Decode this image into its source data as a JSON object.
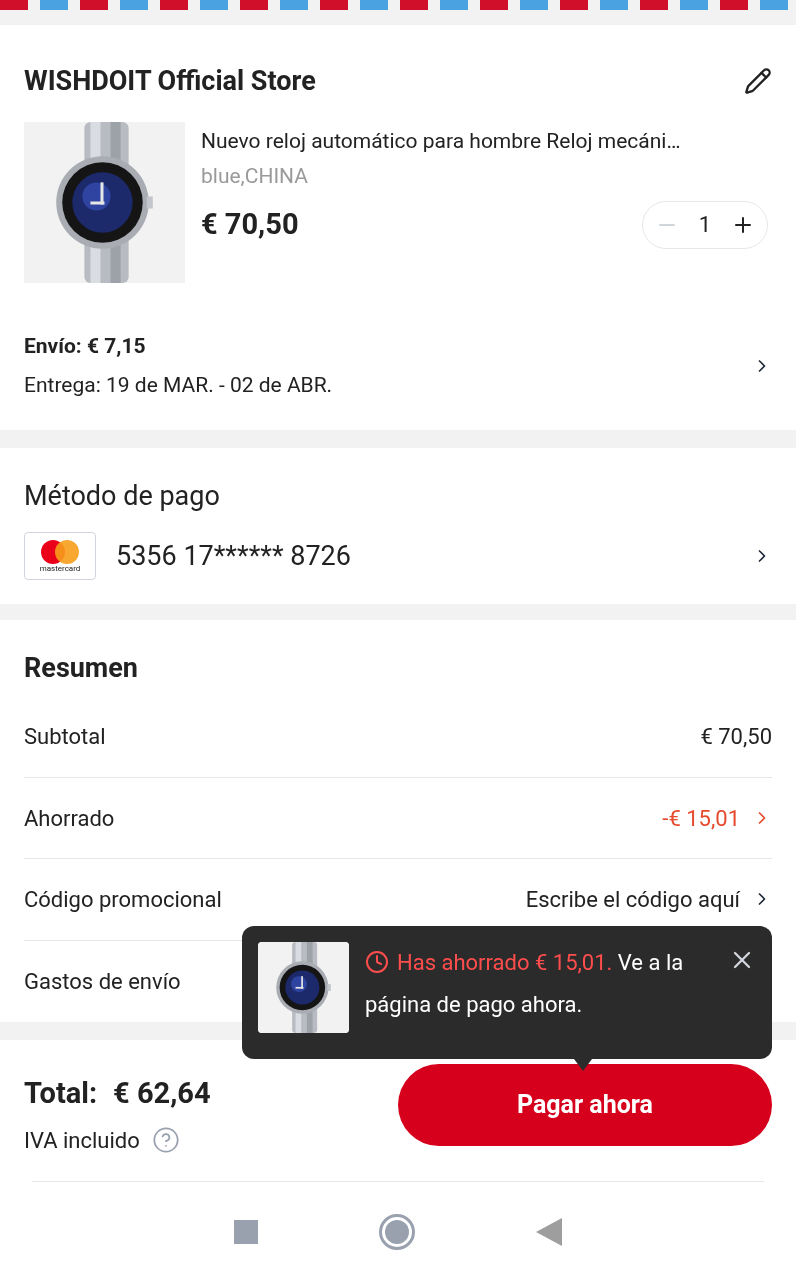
{
  "store": {
    "name": "WISHDOIT Official Store"
  },
  "product": {
    "title": "Nuevo reloj automático para hombre Reloj mecáni…",
    "variant": "blue,CHINA",
    "price": "€ 70,50",
    "quantity": "1",
    "minus_disabled": true
  },
  "shipping": {
    "cost": "Envío: € 7,15",
    "delivery": "Entrega: 19 de MAR. - 02 de ABR."
  },
  "payment": {
    "title": "Método de pago",
    "card_brand": "mastercard",
    "card_number": "5356 17****** 8726"
  },
  "summary": {
    "title": "Resumen",
    "rows": [
      {
        "label": "Subtotal",
        "value": "€ 70,50",
        "kind": "plain"
      },
      {
        "label": "Ahorrado",
        "value": "-€ 15,01",
        "kind": "discount"
      },
      {
        "label": "Código promocional",
        "value": "Escribe el código aquí",
        "kind": "link"
      },
      {
        "label": "Gastos de envío",
        "kind": "hidden"
      }
    ]
  },
  "tooltip": {
    "highlight": "Has ahorrado € 15,01.",
    "text": " Ve a la página de pago ahora."
  },
  "footer": {
    "total_label": "Total:",
    "total": "€ 62,64",
    "tax_note": "IVA incluido",
    "pay_button": "Pagar ahora"
  }
}
